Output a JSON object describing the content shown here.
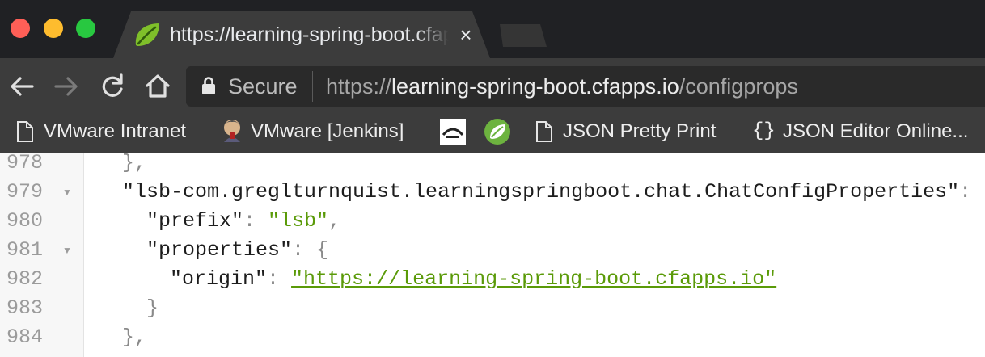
{
  "window": {
    "tab_title": "https://learning-spring-boot.cfapps.io/configprops",
    "tab_close": "×"
  },
  "toolbar": {
    "secure_label": "Secure",
    "url_scheme": "https://",
    "url_host": "learning-spring-boot.cfapps.io",
    "url_path": "/configprops"
  },
  "bookmarks": [
    {
      "label": "VMware Intranet",
      "icon": "page-icon"
    },
    {
      "label": "VMware [Jenkins]",
      "icon": "jenkins-icon"
    },
    {
      "label": "",
      "icon": "sonar-icon"
    },
    {
      "label": "",
      "icon": "spring-icon"
    },
    {
      "label": "JSON Pretty Print",
      "icon": "page-icon"
    },
    {
      "label": "JSON Editor Online...",
      "icon": "braces-icon"
    }
  ],
  "code": {
    "line_numbers": [
      "978",
      "979",
      "980",
      "981",
      "982",
      "983",
      "984"
    ],
    "l978_close": "},",
    "l979_key": "\"lsb-com.greglturnquist.learningspringboot.chat.ChatConfigProperties\"",
    "l979_colon": ": {",
    "l980_key": "\"prefix\"",
    "l980_colon": ": ",
    "l980_value": "\"lsb\"",
    "l980_comma": ",",
    "l981_key": "\"properties\"",
    "l981_colon": ": {",
    "l982_key": "\"origin\"",
    "l982_colon": ": ",
    "l982_value": "\"https://learning-spring-boot.cfapps.io\"",
    "l983_close": "}",
    "l984_close": "},",
    "fold_glyph": "▼"
  },
  "colors": {
    "titlebar": "#202124",
    "toolbar": "#3c3c3c",
    "string": "#5a9a08",
    "line_number": "#9b9b9b"
  }
}
